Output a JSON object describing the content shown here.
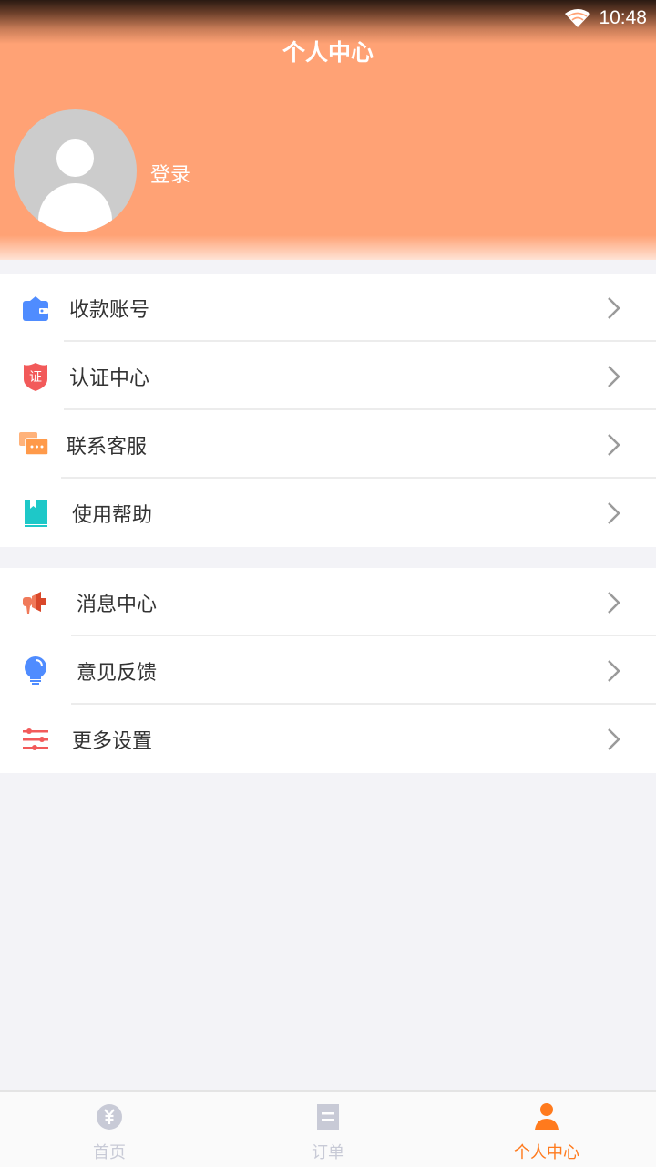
{
  "status_bar": {
    "time": "10:48",
    "wifi_icon": "wifi-icon"
  },
  "header": {
    "title": "个人中心",
    "login_label": "登录",
    "avatar_icon": "user-avatar-icon"
  },
  "menu_group_1": [
    {
      "label": "收款账号",
      "icon": "wallet-icon",
      "color": "#4f8cff"
    },
    {
      "label": "认证中心",
      "icon": "certificate-shield-icon",
      "color": "#f25a5a"
    },
    {
      "label": "联系客服",
      "icon": "chat-bubbles-icon",
      "color": "#ffa25a"
    },
    {
      "label": "使用帮助",
      "icon": "bookmark-book-icon",
      "color": "#1ec8c8"
    }
  ],
  "menu_group_2": [
    {
      "label": "消息中心",
      "icon": "megaphone-icon",
      "color": "#f0603c"
    },
    {
      "label": "意见反馈",
      "icon": "lightbulb-icon",
      "color": "#4f8cff"
    },
    {
      "label": "更多设置",
      "icon": "sliders-icon",
      "color": "#f25a5a"
    }
  ],
  "tabbar": {
    "tabs": [
      {
        "label": "首页",
        "icon": "yuan-coin-icon",
        "active": false
      },
      {
        "label": "订单",
        "icon": "document-icon",
        "active": false
      },
      {
        "label": "个人中心",
        "icon": "person-icon",
        "active": true
      }
    ],
    "active_color": "#ff7a1d",
    "inactive_color": "#c8cad6"
  },
  "colors": {
    "header_bg": "#ffa275",
    "page_bg": "#f3f3f7"
  }
}
